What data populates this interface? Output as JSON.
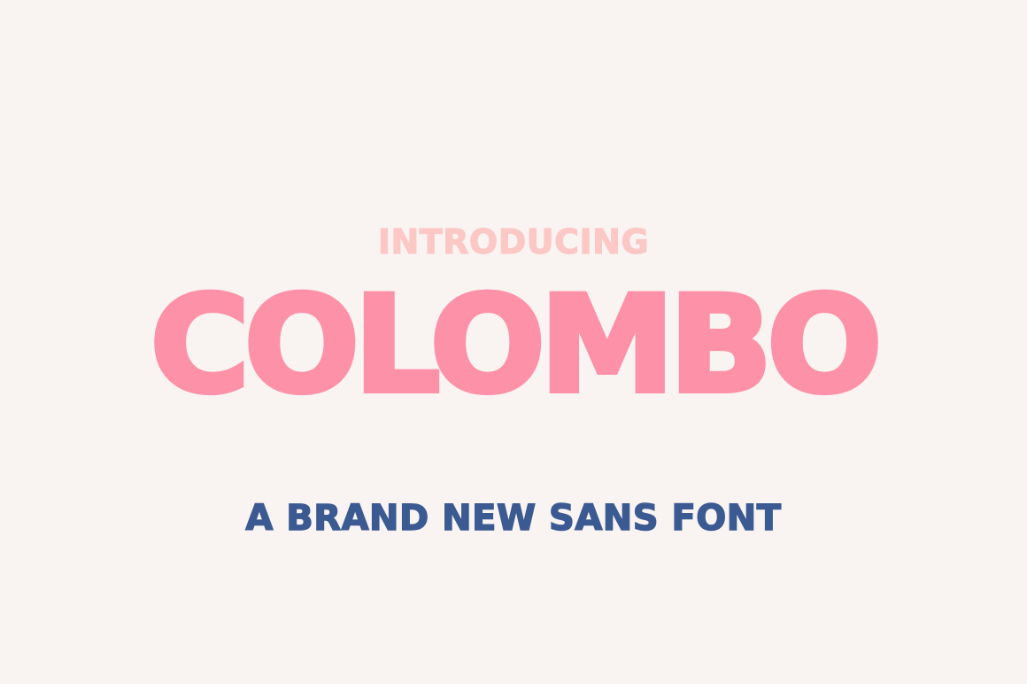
{
  "colors": {
    "background": "#f9f4f2",
    "intro": "#fcc8c6",
    "title": "#fd91a7",
    "tagline": "#3c5a92"
  },
  "poster": {
    "intro": "INTRODUCING",
    "title": "COLOMBO",
    "tagline": "A BRAND NEW SANS FONT"
  }
}
